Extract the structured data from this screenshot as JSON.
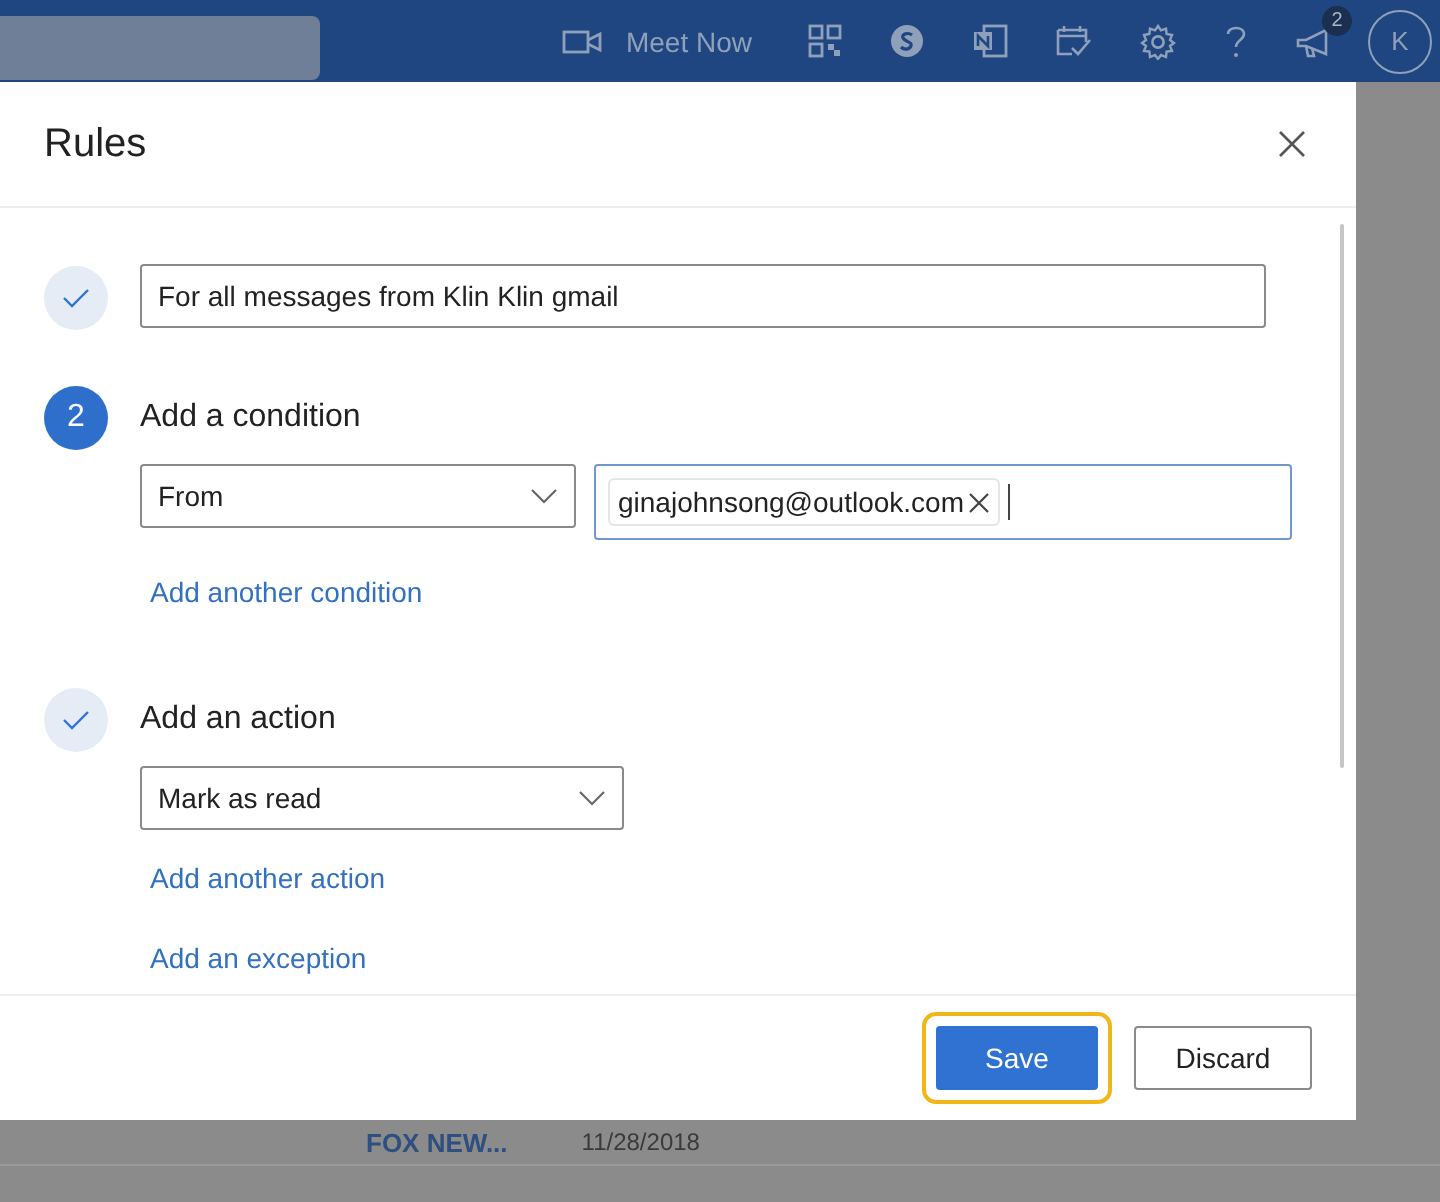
{
  "top_bar": {
    "meet_now": "Meet Now",
    "notification_count": "2",
    "avatar": "K"
  },
  "dialog": {
    "title": "Rules",
    "steps": [
      {
        "kind": "name",
        "done": true,
        "value": "For all messages from Klin Klin gmail"
      },
      {
        "kind": "condition",
        "done": false,
        "number": "2",
        "title": "Add a condition",
        "dropdown": "From",
        "chips": [
          "ginajohnsong@outlook.com"
        ],
        "links": [
          "Add another condition"
        ]
      },
      {
        "kind": "action",
        "done": true,
        "title": "Add an action",
        "dropdown": "Mark as read",
        "links": [
          "Add another action",
          "Add an exception"
        ]
      }
    ],
    "buttons": [
      {
        "label": "Save",
        "primary": true,
        "focused": true
      },
      {
        "label": "Discard",
        "primary": false,
        "focused": false
      }
    ]
  },
  "background_row": {
    "sender": "FOX NEW...",
    "date": "11/28/2018"
  }
}
